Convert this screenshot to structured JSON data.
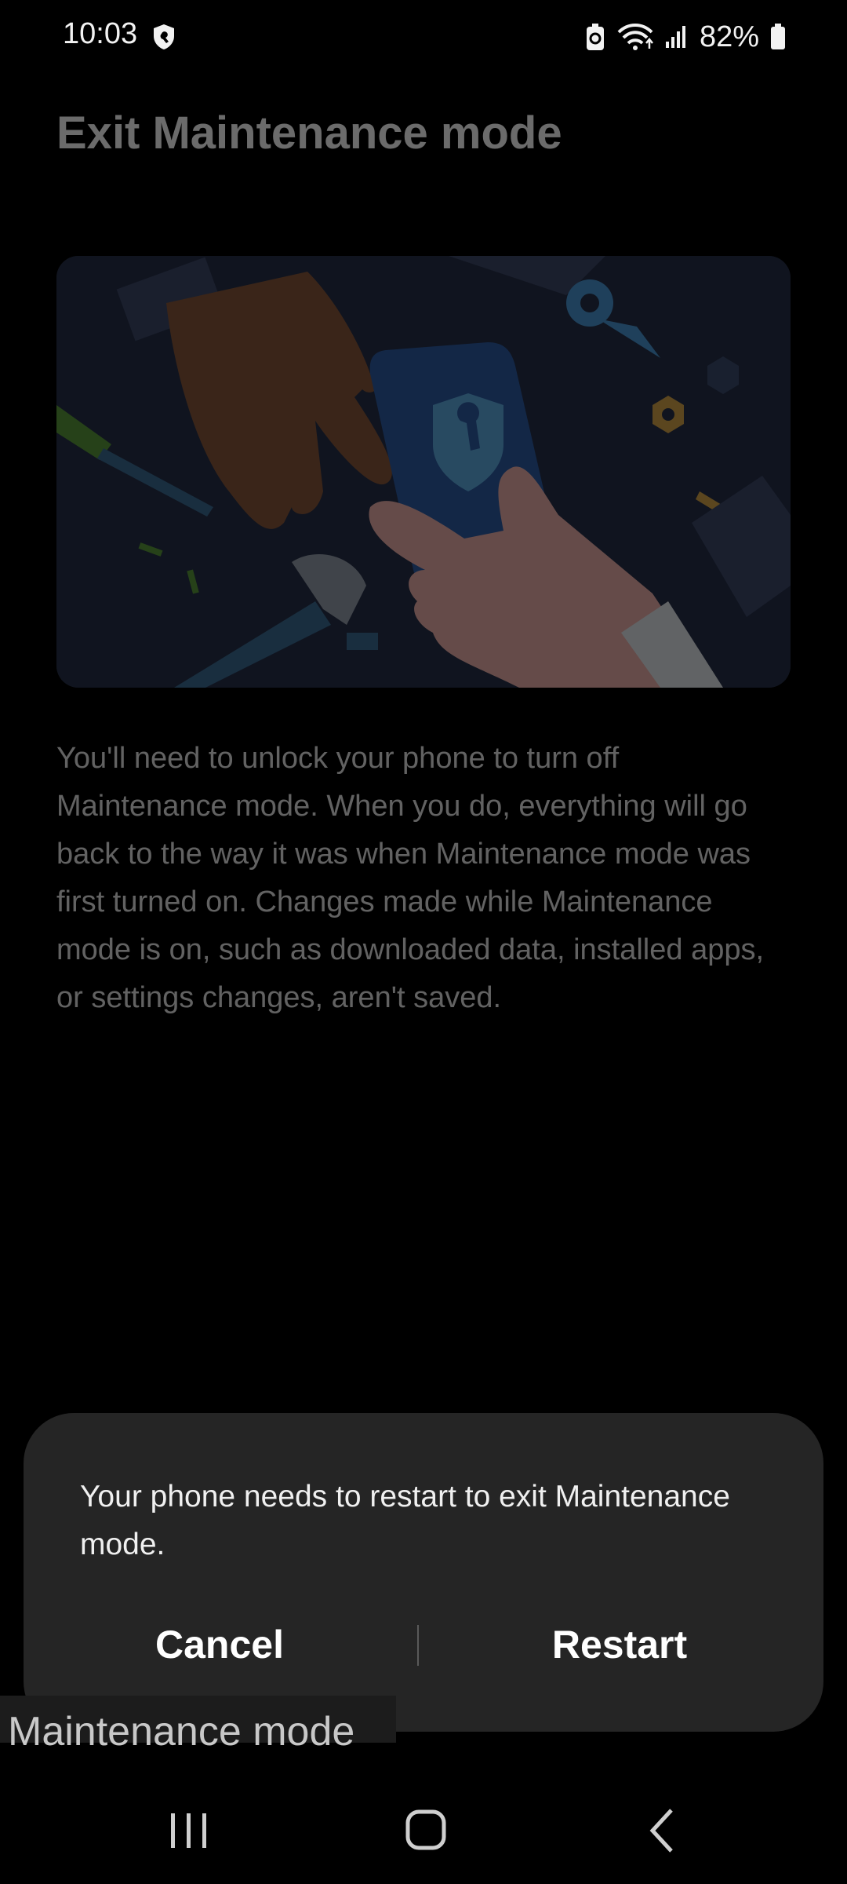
{
  "status_bar": {
    "time": "10:03",
    "battery_percent": "82%",
    "icons": [
      "shield-icon",
      "data-saver-icon",
      "wifi-icon",
      "signal-icon",
      "battery-icon"
    ]
  },
  "page": {
    "title": "Exit Maintenance mode",
    "body": "You'll need to unlock your phone to turn off Maintenance mode. When you do, everything will go back to the way it was when Maintenance mode was first turned on. Changes made while Maintenance mode is on, such as downloaded data, installed apps, or settings changes, aren't saved.",
    "illustration": "maintenance-illustration"
  },
  "dialog": {
    "message": "Your phone needs to restart to exit Maintenance mode.",
    "cancel_label": "Cancel",
    "restart_label": "Restart"
  },
  "overlay_label": "Maintenance mode",
  "nav_bar": {
    "icons": [
      "recents-icon",
      "home-icon",
      "back-icon"
    ]
  },
  "colors": {
    "background": "#000000",
    "dialog_background": "#252525",
    "text": "#ffffff"
  }
}
